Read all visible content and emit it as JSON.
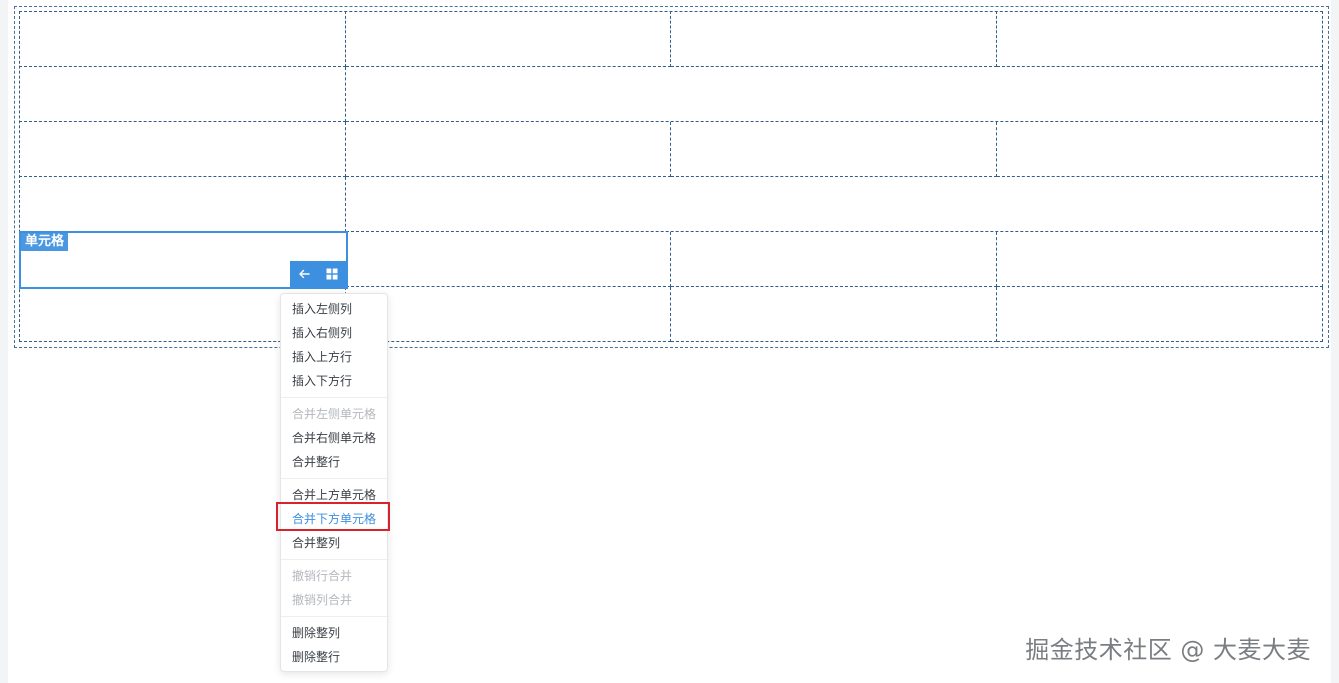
{
  "cell_tag": "单元格",
  "toolbar": {
    "back_icon": "arrow-left-icon",
    "grid_icon": "grid-icon"
  },
  "context_menu": {
    "items": [
      {
        "label": "插入左侧列",
        "state": "enabled"
      },
      {
        "label": "插入右侧列",
        "state": "enabled"
      },
      {
        "label": "插入上方行",
        "state": "enabled"
      },
      {
        "label": "插入下方行",
        "state": "enabled"
      },
      {
        "label": "合并左侧单元格",
        "state": "disabled"
      },
      {
        "label": "合并右侧单元格",
        "state": "enabled"
      },
      {
        "label": "合并整行",
        "state": "enabled"
      },
      {
        "label": "合并上方单元格",
        "state": "enabled"
      },
      {
        "label": "合并下方单元格",
        "state": "active"
      },
      {
        "label": "合并整列",
        "state": "enabled"
      },
      {
        "label": "撤销行合并",
        "state": "disabled"
      },
      {
        "label": "撤销列合并",
        "state": "disabled"
      },
      {
        "label": "删除整列",
        "state": "enabled"
      },
      {
        "label": "删除整行",
        "state": "enabled"
      }
    ]
  },
  "colors": {
    "accent": "#3d8fe0",
    "highlight": "#d8232a",
    "dashed_border": "#2f5f8f"
  },
  "watermark": "掘金技术社区 @ 大麦大麦"
}
